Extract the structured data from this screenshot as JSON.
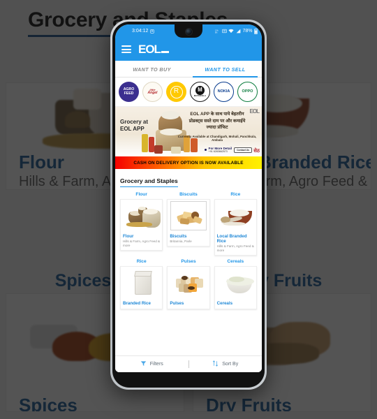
{
  "background": {
    "page_title": "Grocery and Staples",
    "sections": [
      {
        "heading": "Flour"
      },
      {
        "heading": "Spices"
      },
      {
        "heading": "Dry Fruits"
      }
    ],
    "cards": [
      {
        "name": "Flour",
        "sub": "Hills & Farm, Agro Feed & more"
      },
      {
        "name": "Local Branded Rice",
        "sub": "Hills & Farm, Agro Feed & more"
      },
      {
        "name": "Spices",
        "sub": ""
      },
      {
        "name": "Dry Fruits",
        "sub": ""
      }
    ],
    "heading_left_partial": "Flour",
    "heading_mid_partial": "Spices",
    "heading_right_partial": "Dry Fruits"
  },
  "phone": {
    "statusbar": {
      "time": "3:04:12",
      "battery": "78%",
      "icons": [
        "alarm-icon",
        "data-speed-icon",
        "sd-card-icon",
        "wifi-icon",
        "signal-icon",
        "battery-icon"
      ]
    },
    "appbar": {
      "menu": "menu-icon",
      "logo": "EOL"
    },
    "tabs": [
      {
        "label": "WANT TO BUY",
        "active": false
      },
      {
        "label": "WANT TO SELL",
        "active": true
      }
    ],
    "brands": [
      {
        "name": "AGRO FEED",
        "line1": "AGRO",
        "line2": "FEED"
      },
      {
        "name": "Little Angel",
        "line1": "little",
        "line2": "Angel"
      },
      {
        "name": "realme",
        "line1": "R",
        "line2": ""
      },
      {
        "name": "Motorola",
        "line1": "M",
        "line2": "MOTOROLA"
      },
      {
        "name": "NOKIA",
        "line1": "NOKIA",
        "line2": ""
      },
      {
        "name": "OPPO",
        "line1": "OPPO",
        "line2": ""
      }
    ],
    "promo": {
      "left_line1": "Grocery at",
      "left_line2": "EOL APP",
      "hindi_line1": "EOL APP के साथ पाये बेहतरीन",
      "hindi_line2": "प्रोडक्ट्स सस्ते दाम पर और कमाईये",
      "hindi_line3": "ज्यादा प्रॉफिट",
      "availability": "Currently Available at Chandigarh, Mohali, Panchkula, Ambala",
      "detail_label": "For More Detail",
      "phone": "+91 6283662573",
      "button": "Contact Us",
      "logo_tr": "EOL",
      "logo_br": "सेठ"
    },
    "cod_banner": "CASH ON DELIVERY OPTION IS NOW AVAILABLE",
    "section_title": "Grocery and Staples",
    "products": [
      {
        "category": "Flour",
        "name": "Flour",
        "sub": "Hills & Farm, Agro Feed & more",
        "art": "flour",
        "framed": false
      },
      {
        "category": "Biscuits",
        "name": "Biscuits",
        "sub": "Britannia, Parle",
        "art": "biscuits",
        "framed": true
      },
      {
        "category": "Rice",
        "name": "Local Branded Rice",
        "sub": "Hills & Farm, Agro Feed & more",
        "art": "ricebowl",
        "framed": false
      },
      {
        "category": "Rice",
        "name": "Branded Rice",
        "sub": "",
        "art": "ricepack",
        "framed": false
      },
      {
        "category": "Pulses",
        "name": "Pulses",
        "sub": "",
        "art": "pulses",
        "framed": false
      },
      {
        "category": "Cereals",
        "name": "Cereals",
        "sub": "",
        "art": "cereals",
        "framed": false
      }
    ],
    "bottombar": {
      "filters_label": "Filters",
      "sort_label": "Sort By"
    }
  },
  "colors": {
    "brand_blue": "#2196e8",
    "link_blue": "#1e87d6",
    "bg_heading_blue": "#1b5c96",
    "cod_red": "#f40000",
    "cod_yellow": "#fff000"
  }
}
